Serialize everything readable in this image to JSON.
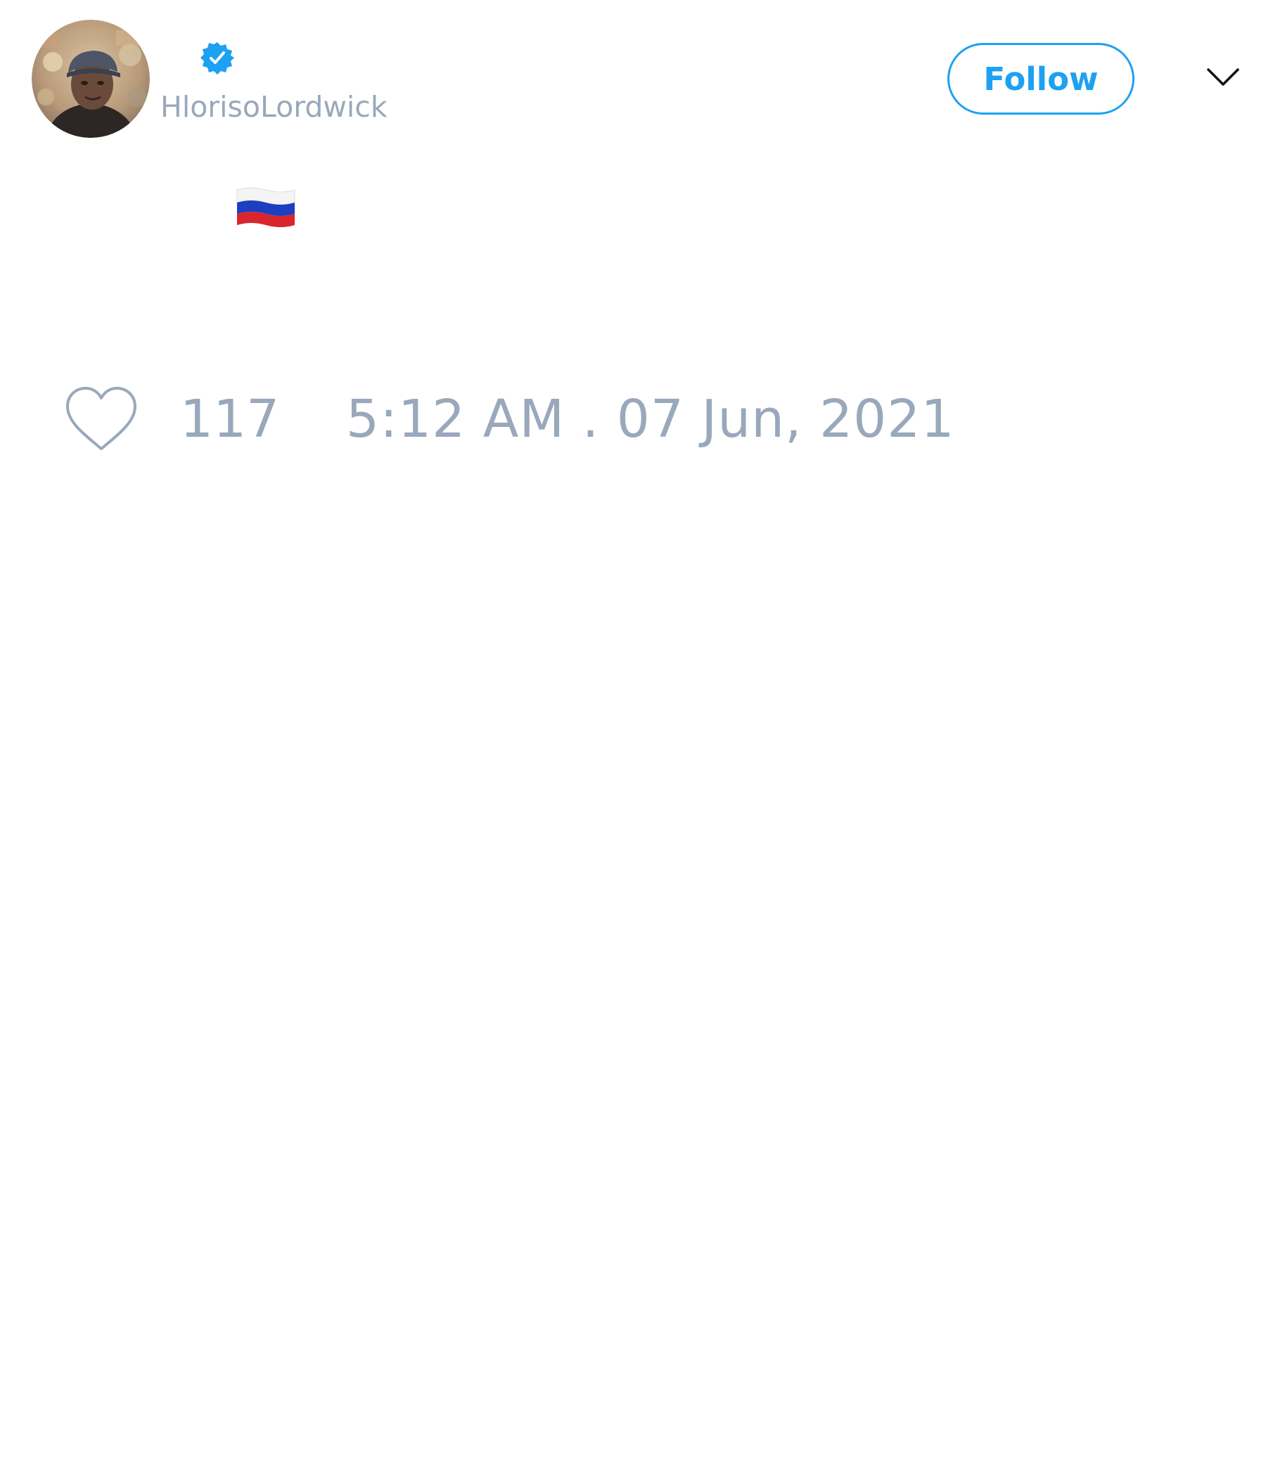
{
  "tweet": {
    "author": {
      "handle": "HlorisoLordwick",
      "verified": true,
      "avatar_icon": "user-avatar-photo",
      "verified_icon": "verified-badge-icon"
    },
    "follow_label": "Follow",
    "menu_icon": "chevron-down-icon",
    "content": {
      "emoji_name": "flag-russia-icon"
    },
    "likes": {
      "icon": "heart-icon",
      "count": "117"
    },
    "timestamp": "5:12 AM . 07 Jun, 2021"
  },
  "colors": {
    "accent": "#1da1f2",
    "muted_text": "#99a8bb",
    "background": "#ffffff"
  }
}
